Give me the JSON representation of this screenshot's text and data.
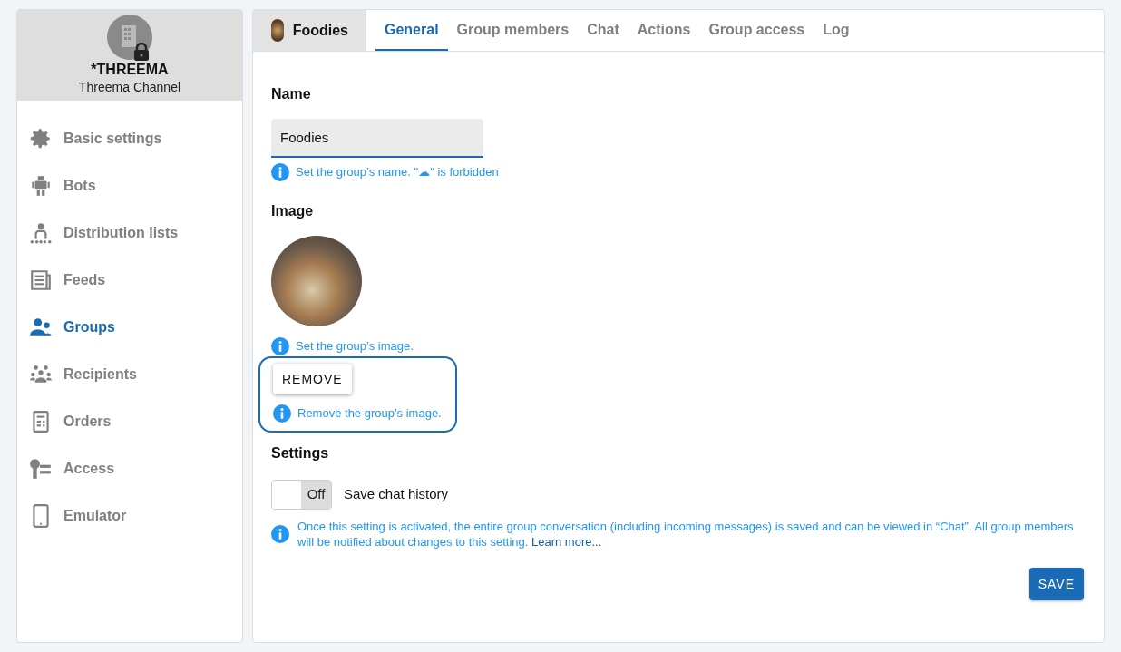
{
  "sidebar": {
    "account_name": "*THREEMA",
    "account_type": "Threema Channel",
    "items": [
      {
        "label": "Basic settings",
        "selected": false
      },
      {
        "label": "Bots",
        "selected": false
      },
      {
        "label": "Distribution lists",
        "selected": false
      },
      {
        "label": "Feeds",
        "selected": false
      },
      {
        "label": "Groups",
        "selected": true
      },
      {
        "label": "Recipients",
        "selected": false
      },
      {
        "label": "Orders",
        "selected": false
      },
      {
        "label": "Access",
        "selected": false
      },
      {
        "label": "Emulator",
        "selected": false
      }
    ]
  },
  "group_header": {
    "name": "Foodies"
  },
  "tabs": [
    {
      "label": "General",
      "selected": true
    },
    {
      "label": "Group members",
      "selected": false
    },
    {
      "label": "Chat",
      "selected": false
    },
    {
      "label": "Actions",
      "selected": false
    },
    {
      "label": "Group access",
      "selected": false
    },
    {
      "label": "Log",
      "selected": false
    }
  ],
  "name_section": {
    "heading": "Name",
    "value": "Foodies",
    "hint": "Set the group’s name. \"☁\" is forbidden"
  },
  "image_section": {
    "heading": "Image",
    "hint": "Set the group’s image.",
    "remove_button": "REMOVE",
    "remove_hint": "Remove the group’s image."
  },
  "settings_section": {
    "heading": "Settings",
    "toggle": {
      "on": false,
      "state_label": "Off",
      "label": "Save chat history"
    },
    "hint": "Once this setting is activated, the entire group conversation (including incoming messages) is saved and can be viewed in “Chat”. All group members will be notified about changes to this setting.",
    "link": "Learn more..."
  },
  "save_button": "SAVE"
}
